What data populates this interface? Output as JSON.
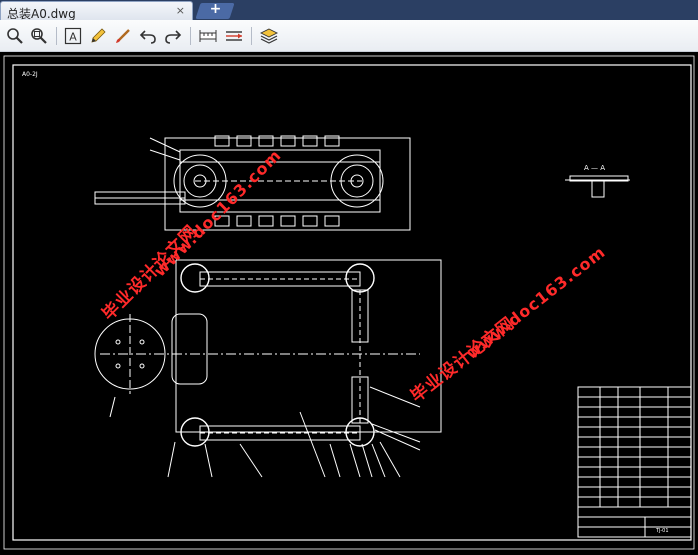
{
  "tab": {
    "title": "总装A0.dwg",
    "close": "×",
    "new_tab": "+"
  },
  "toolbar": {
    "buttons": [
      {
        "name": "zoom-icon"
      },
      {
        "name": "zoom-window-icon"
      },
      {
        "name": "text-icon"
      },
      {
        "name": "pencil-icon"
      },
      {
        "name": "brush-icon"
      },
      {
        "name": "undo-icon"
      },
      {
        "name": "redo-icon"
      },
      {
        "name": "measure-icon"
      },
      {
        "name": "dimension-icon"
      },
      {
        "name": "layers-icon"
      }
    ]
  },
  "drawing": {
    "corner_label": "A0-2J",
    "section_label": "A — A",
    "watermark_left_cn": "毕业设计论文网",
    "watermark_left_url": "www.doc163.com",
    "watermark_right_cn": "毕业设计论文网",
    "watermark_right_url": "www.doc163.com",
    "titleblock_label": "TJ-01"
  },
  "colors": {
    "canvas": "#000000",
    "lines": "#ffffff",
    "watermark": "#ff2a2a",
    "tabbar": "#2b3f63"
  }
}
